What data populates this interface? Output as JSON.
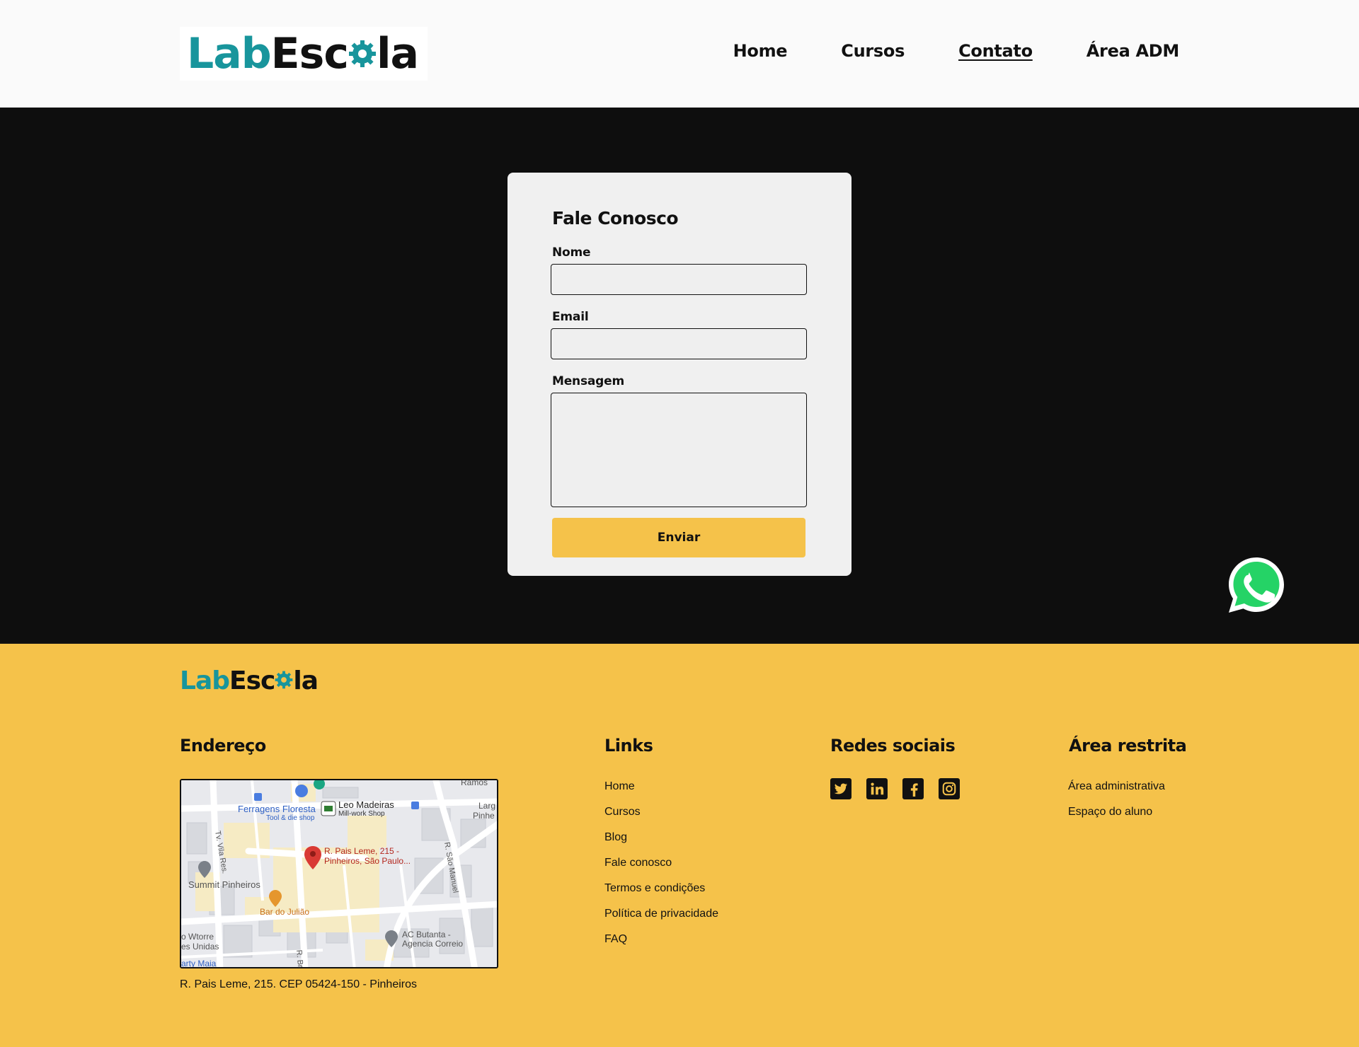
{
  "header": {
    "logo": {
      "part1": "Lab",
      "part2": "Esc",
      "part3": "la"
    },
    "nav": [
      {
        "label": "Home",
        "active": false
      },
      {
        "label": "Cursos",
        "active": false
      },
      {
        "label": "Contato",
        "active": true
      },
      {
        "label": "Área ADM",
        "active": false
      }
    ]
  },
  "form": {
    "title": "Fale Conosco",
    "name_label": "Nome",
    "name_value": "",
    "email_label": "Email",
    "email_value": "",
    "message_label": "Mensagem",
    "message_value": "",
    "submit_label": "Enviar"
  },
  "footer": {
    "logo": {
      "part1": "Lab",
      "part2": "Esc",
      "part3": "la"
    },
    "address": {
      "title": "Endereço",
      "text": "R. Pais Leme, 215. CEP 05424-150 - Pinheiros",
      "map": {
        "labels": {
          "ramos": "Ramos",
          "ferragens": "Ferragens Floresta",
          "ferragens_sub": "Tool & die shop",
          "leo": "Leo Madeiras",
          "leo_sub": "Mill-work Shop",
          "larg": "Larg",
          "pinhe": "Pinhe",
          "vila": "Tv. Vila Res.",
          "pin_line1": "R. Pais Leme, 215 -",
          "pin_line2": "Pinheiros, São Paulo...",
          "sao_manuel": "R. São Manuel",
          "summit": "Summit Pinheiros",
          "bar": "Bar do Julião",
          "wtorre": "o Wtorre",
          "unidas": "es Unidas",
          "maia": "arty Maia",
          "ac1": "AC Butanta -",
          "ac2": "Agencia Correio",
          "rbr": "R. Br"
        }
      }
    },
    "links": {
      "title": "Links",
      "items": [
        "Home",
        "Cursos",
        "Blog",
        "Fale conosco",
        "Termos e condições",
        "Política de privacidade",
        "FAQ"
      ]
    },
    "social": {
      "title": "Redes sociais",
      "icons": [
        "twitter-icon",
        "linkedin-icon",
        "facebook-icon",
        "instagram-icon"
      ]
    },
    "restricted": {
      "title": "Área restrita",
      "items": [
        "Área administrativa",
        "Espaço do aluno"
      ]
    }
  },
  "colors": {
    "accent_yellow": "#f5c24a",
    "brand_teal": "#18959c",
    "dark_bg": "#0e0e0e",
    "whatsapp_green": "#25d366"
  }
}
